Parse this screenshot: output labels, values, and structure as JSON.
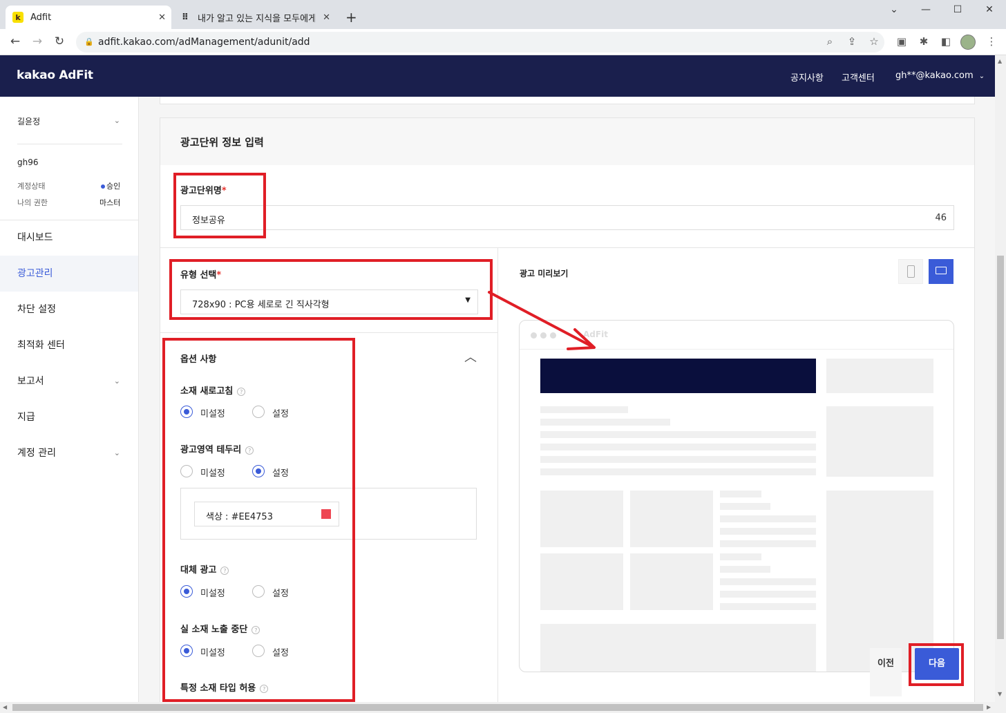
{
  "browser": {
    "tabs": [
      {
        "title": "Adfit",
        "favicon": "k"
      },
      {
        "title": "내가 알고 있는 지식을 모두에게",
        "favicon": "dots-icon"
      }
    ],
    "new_tab": "+",
    "url": "adfit.kakao.com/adManagement/adunit/add"
  },
  "header": {
    "logo": "kakao AdFit",
    "links": [
      "공지사항",
      "고객센터"
    ],
    "account": "gh**@kakao.com"
  },
  "sidebar": {
    "user_name": "길윤정",
    "account_id": "gh96",
    "status_label": "계정상태",
    "status_value": "승인",
    "role_label": "나의 권한",
    "role_value": "마스터",
    "items": [
      {
        "label": "대시보드",
        "expandable": false,
        "active": false
      },
      {
        "label": "광고관리",
        "expandable": false,
        "active": true
      },
      {
        "label": "차단 설정",
        "expandable": false,
        "active": false
      },
      {
        "label": "최적화 센터",
        "expandable": false,
        "active": false
      },
      {
        "label": "보고서",
        "expandable": true,
        "active": false
      },
      {
        "label": "지급",
        "expandable": false,
        "active": false
      },
      {
        "label": "계정 관리",
        "expandable": true,
        "active": false
      }
    ]
  },
  "form": {
    "section_title": "광고단위 정보 입력",
    "name_label": "광고단위명",
    "required_mark": "*",
    "name_value": "정보공유",
    "name_remaining": "46",
    "type_label": "유형 선택",
    "type_value": "728x90 : PC용 세로로 긴 직사각형",
    "options_title": "옵션 사항",
    "options": [
      {
        "label": "소재 새로고침",
        "selected": "미설정"
      },
      {
        "label": "광고영역 테두리",
        "selected": "설정"
      },
      {
        "label": "대체 광고",
        "selected": "미설정"
      },
      {
        "label": "실 소재 노출 중단",
        "selected": "미설정"
      },
      {
        "label": "특정 소재 타입 허용",
        "selected": null
      }
    ],
    "radio_off": "미설정",
    "radio_on": "설정",
    "border_color_label": "색상 : #EE4753",
    "border_color": "#EE4753"
  },
  "preview": {
    "title": "광고 미리보기",
    "mock_brand": "AdFit",
    "banner_color": "#0a0f3d"
  },
  "actions": {
    "prev": "이전",
    "next": "다음"
  },
  "colors": {
    "header_bg": "#1a1f4d",
    "accent": "#3a5bd8",
    "annotation_red": "#e01e26"
  }
}
